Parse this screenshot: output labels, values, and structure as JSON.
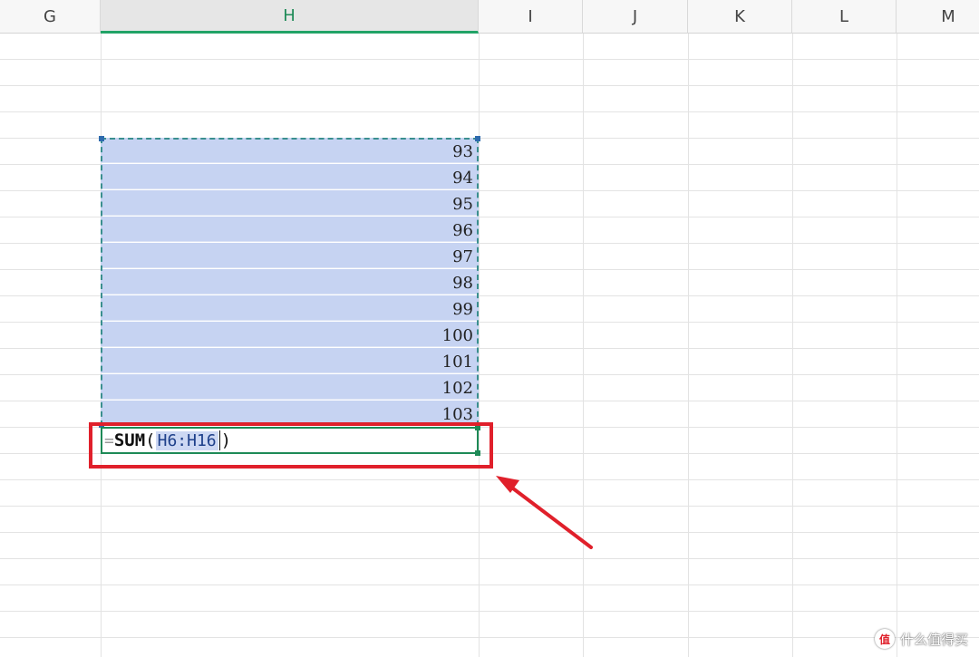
{
  "columns": [
    {
      "label": "G",
      "active": false
    },
    {
      "label": "H",
      "active": true
    },
    {
      "label": "I",
      "active": false
    },
    {
      "label": "J",
      "active": false
    },
    {
      "label": "K",
      "active": false
    },
    {
      "label": "L",
      "active": false
    },
    {
      "label": "M",
      "active": false
    }
  ],
  "selected_range": {
    "values": [
      "93",
      "94",
      "95",
      "96",
      "97",
      "98",
      "99",
      "100",
      "101",
      "102",
      "103"
    ]
  },
  "editing_cell": {
    "equals": "=",
    "function": "SUM",
    "open_paren": "(",
    "reference": "H6:H16",
    "close_paren": ")"
  },
  "watermark": {
    "logo": "值",
    "text": "什么值得买"
  },
  "colors": {
    "selection_fill": "#c6d3f2",
    "active_header": "#21a366",
    "highlight": "#e0202b",
    "marquee": "#3a8f8f"
  },
  "icons": {
    "annotation": "red-arrow-icon",
    "watermark": "zhidemai-logo-icon"
  }
}
